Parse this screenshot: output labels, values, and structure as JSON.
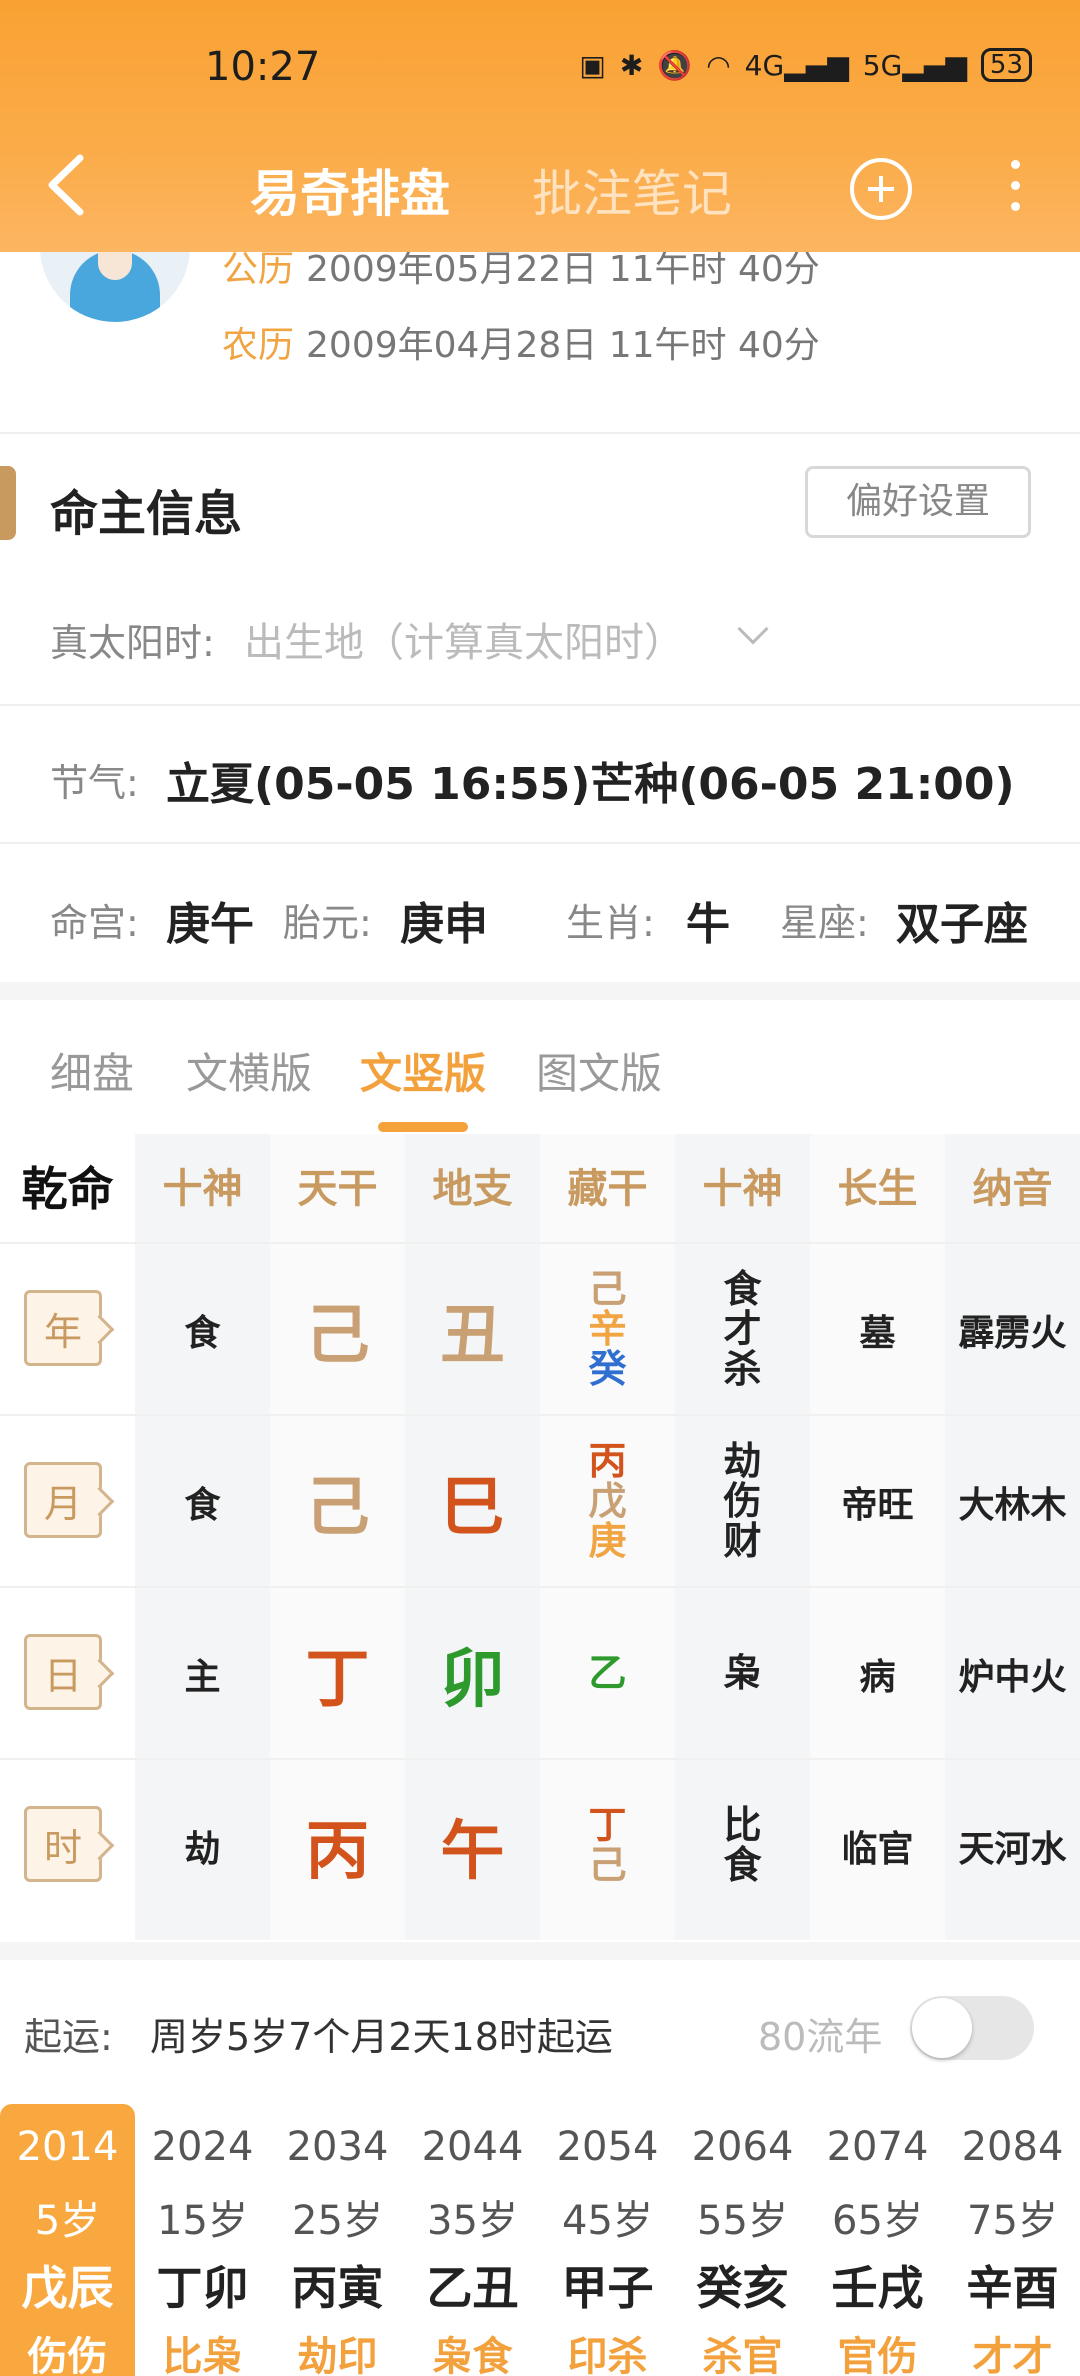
{
  "status_bar": {
    "time": "10:27",
    "network": "4G",
    "network2": "5G",
    "battery": "53"
  },
  "nav": {
    "tab_active": "易奇排盘",
    "tab_inactive": "批注笔记"
  },
  "profile": {
    "solar_label": "公历",
    "solar_value": "2009年05月22日 11午时 40分",
    "lunar_label": "农历",
    "lunar_value": "2009年04月28日 11午时 40分"
  },
  "section": {
    "title": "命主信息",
    "pref_button": "偏好设置"
  },
  "true_solar": {
    "label": "真太阳时:",
    "placeholder": "出生地（计算真太阳时）"
  },
  "jieqi": {
    "label": "节气:",
    "value": "立夏(05-05 16:55)芒种(06-05 21:00)"
  },
  "palace": {
    "minggong_label": "命宫:",
    "minggong_value": "庚午",
    "taiyuan_label": "胎元:",
    "taiyuan_value": "庚申",
    "shengxiao_label": "生肖:",
    "shengxiao_value": "牛",
    "xingzuo_label": "星座:",
    "xingzuo_value": "双子座"
  },
  "tabs": [
    "细盘",
    "文横版",
    "文竖版",
    "图文版"
  ],
  "table": {
    "corner": "乾命",
    "headers": [
      "十神",
      "天干",
      "地支",
      "藏干",
      "十神",
      "长生",
      "纳音"
    ],
    "rows": [
      {
        "tag": "年",
        "shishen": "食",
        "gan": "己",
        "zhi": "丑",
        "zanggan": [
          "己",
          "辛",
          "癸"
        ],
        "shishen2": [
          "食",
          "才",
          "杀"
        ],
        "changsheng": "墓",
        "nayin": "霹雳火"
      },
      {
        "tag": "月",
        "shishen": "食",
        "gan": "己",
        "zhi": "巳",
        "zanggan": [
          "丙",
          "戊",
          "庚"
        ],
        "shishen2": [
          "劫",
          "伤",
          "财"
        ],
        "changsheng": "帝旺",
        "nayin": "大林木"
      },
      {
        "tag": "日",
        "shishen": "主",
        "gan": "丁",
        "zhi": "卯",
        "zanggan": [
          "乙"
        ],
        "shishen2": [
          "枭"
        ],
        "changsheng": "病",
        "nayin": "炉中火"
      },
      {
        "tag": "时",
        "shishen": "劫",
        "gan": "丙",
        "zhi": "午",
        "zanggan": [
          "丁",
          "己"
        ],
        "shishen2": [
          "比",
          "食"
        ],
        "changsheng": "临官",
        "nayin": "天河水"
      }
    ]
  },
  "colors": {
    "earth": "#c8a074",
    "fire": "#d2541c",
    "wood": "#2e9a2e",
    "water": "#2f6fd0",
    "metal": "#f0a442",
    "accent": "#f5a23a"
  },
  "qiyun": {
    "label": "起运:",
    "value": "周岁5岁7个月2天18时起运",
    "liunian_label": "80流年"
  },
  "dayun": [
    {
      "year": "2014",
      "age": "5岁",
      "ganzhi": "戊辰",
      "shishen": "伤伤"
    },
    {
      "year": "2024",
      "age": "15岁",
      "ganzhi": "丁卯",
      "shishen": "比枭"
    },
    {
      "year": "2034",
      "age": "25岁",
      "ganzhi": "丙寅",
      "shishen": "劫印"
    },
    {
      "year": "2044",
      "age": "35岁",
      "ganzhi": "乙丑",
      "shishen": "枭食"
    },
    {
      "year": "2054",
      "age": "45岁",
      "ganzhi": "甲子",
      "shishen": "印杀"
    },
    {
      "year": "2064",
      "age": "55岁",
      "ganzhi": "癸亥",
      "shishen": "杀官"
    },
    {
      "year": "2074",
      "age": "65岁",
      "ganzhi": "壬戌",
      "shishen": "官伤"
    },
    {
      "year": "2084",
      "age": "75岁",
      "ganzhi": "辛酉",
      "shishen": "才才"
    }
  ]
}
